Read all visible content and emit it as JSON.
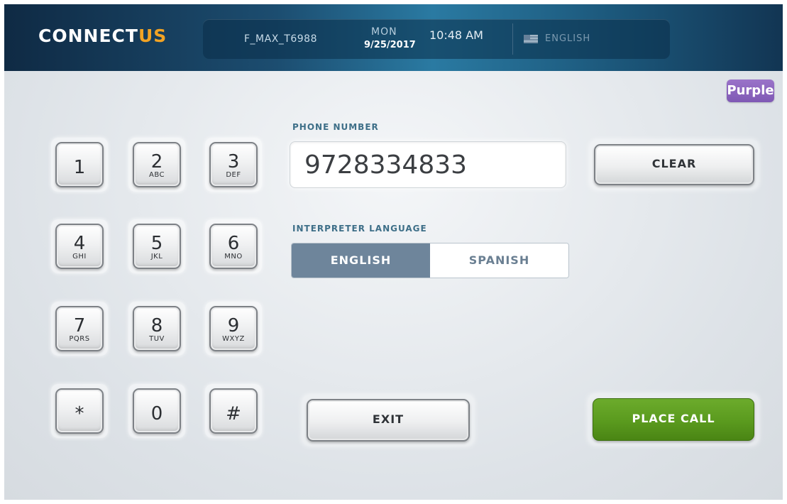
{
  "header": {
    "logo_main": "CONNECT",
    "logo_accent": "US",
    "station_id": "F_MAX_T6988",
    "day": "MON",
    "date": "9/25/2017",
    "time": "10:48 AM",
    "language": "ENGLISH",
    "language_icon": "us-flag-icon"
  },
  "brand_badge": "Purple",
  "keypad": [
    {
      "num": "1",
      "letters": ""
    },
    {
      "num": "2",
      "letters": "ABC"
    },
    {
      "num": "3",
      "letters": "DEF"
    },
    {
      "num": "4",
      "letters": "GHI"
    },
    {
      "num": "5",
      "letters": "JKL"
    },
    {
      "num": "6",
      "letters": "MNO"
    },
    {
      "num": "7",
      "letters": "PQRS"
    },
    {
      "num": "8",
      "letters": "TUV"
    },
    {
      "num": "9",
      "letters": "WXYZ"
    },
    {
      "num": "*",
      "letters": ""
    },
    {
      "num": "0",
      "letters": ""
    },
    {
      "num": "#",
      "letters": ""
    }
  ],
  "phone": {
    "label": "PHONE NUMBER",
    "value": "9728334833",
    "clear_label": "CLEAR"
  },
  "interpreter": {
    "label": "INTERPRETER LANGUAGE",
    "options": [
      "ENGLISH",
      "SPANISH"
    ],
    "selected": "ENGLISH"
  },
  "actions": {
    "exit_label": "EXIT",
    "place_call_label": "PLACE CALL"
  },
  "colors": {
    "accent_orange": "#f2a324",
    "place_call_green": "#5a9a1e",
    "selected_toggle": "#6e859b",
    "label_blue": "#3e6f88",
    "brand_purple": "#8a63bf"
  }
}
